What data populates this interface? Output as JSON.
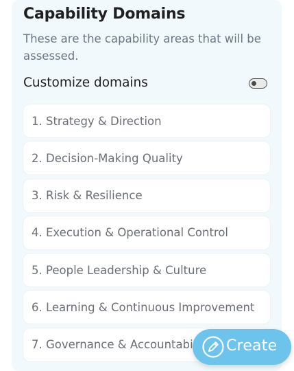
{
  "section": {
    "title": "Capability Domains",
    "subtitle": "These are the capability areas that will be assessed."
  },
  "customize": {
    "label": "Customize domains",
    "toggle_on": false
  },
  "domains": [
    "1. Strategy & Direction",
    "2. Decision-Making Quality",
    "3. Risk & Resilience",
    "4. Execution & Operational Control",
    "5. People Leadership & Culture",
    "6. Learning & Continuous Improvement",
    "7. Governance & Accountability"
  ],
  "fab": {
    "label": "Create",
    "icon": "pencil-icon"
  },
  "colors": {
    "panel_bg": "#f1f9fc",
    "fab_bg": "#6cc3ec",
    "text_dark": "#1f1f1f",
    "text_muted": "#6b7684"
  }
}
